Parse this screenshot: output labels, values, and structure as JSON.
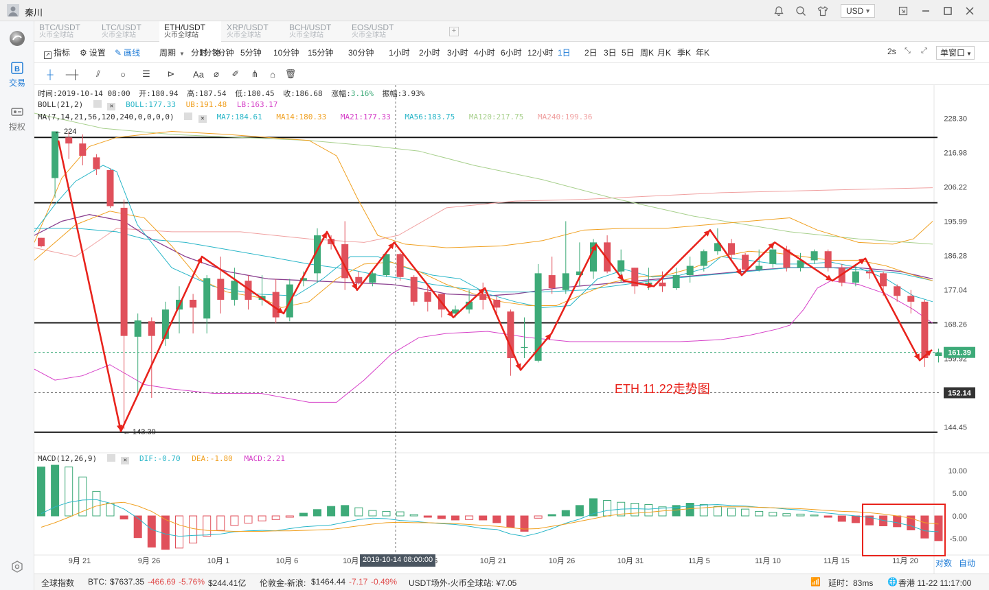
{
  "window": {
    "user_name": "秦川",
    "currency": "USD"
  },
  "sidebar": {
    "items": [
      {
        "label": "交易"
      },
      {
        "label": "授权"
      }
    ]
  },
  "tabs": [
    {
      "pair": "BTC/USDT",
      "exchange": "火币全球站"
    },
    {
      "pair": "LTC/USDT",
      "exchange": "火币全球站"
    },
    {
      "pair": "ETH/USDT",
      "exchange": "火币全球站"
    },
    {
      "pair": "XRP/USDT",
      "exchange": "火币全球站"
    },
    {
      "pair": "BCH/USDT",
      "exchange": "火币全球站"
    },
    {
      "pair": "EOS/USDT",
      "exchange": "火币全球站"
    }
  ],
  "active_tab": 2,
  "toolbar": {
    "indicators": "指标",
    "settings": "设置",
    "draw": "画线",
    "period": "周期",
    "periods": [
      "分时",
      "1分钟",
      "3分钟",
      "5分钟",
      "10分钟",
      "15分钟",
      "30分钟",
      "1小时",
      "2小时",
      "3小时",
      "4小时",
      "6小时",
      "12小时",
      "1日",
      "2日",
      "3日",
      "5日",
      "周K",
      "月K",
      "季K",
      "年K"
    ],
    "active_period": "1日",
    "refresh": "2s",
    "layout": "单窗口"
  },
  "drawtools": {
    "text_tool": "Aa"
  },
  "info": {
    "time_label": "时间:",
    "time": "2019-10-14 08:00",
    "open_label": "开:",
    "open": "180.94",
    "high_label": "高:",
    "high": "187.54",
    "low_label": "低:",
    "low": "180.45",
    "close_label": "收:",
    "close": "186.68",
    "change_label": "涨幅:",
    "change": "3.16%",
    "amp_label": "振幅:",
    "amp": "3.93%"
  },
  "boll": {
    "name": "BOLL(21,2)",
    "boll": "BOLL:177.33",
    "ub": "UB:191.48",
    "lb": "LB:163.17"
  },
  "ma": {
    "name": "MA(7,14,21,56,120,240,0,0,0,0)",
    "ma7": "MA7:184.61",
    "ma14": "MA14:180.33",
    "ma21": "MA21:177.33",
    "ma56": "MA56:183.75",
    "ma120": "MA120:217.75",
    "ma240": "MA240:199.36"
  },
  "macd": {
    "name": "MACD(12,26,9)",
    "dif": "DIF:-0.70",
    "dea": "DEA:-1.80",
    "macd": "MACD:2.21"
  },
  "annotation": "ETH 11.22走势图",
  "high_marker": "← 224",
  "low_marker": "← 143.39",
  "crosshair_label": "2019-10-14 08:00:00",
  "scale_mode": {
    "log": "对数",
    "auto": "自动"
  },
  "colors": {
    "up": "#3daa78",
    "down": "#e0505b",
    "accent": "#1e7bd6",
    "boll_mid": "#8a3f8f",
    "boll_up": "#f0a020",
    "ma_cyan": "#29b6c8",
    "ma120": "#a8d08d",
    "ma240": "#f0a0a0",
    "ma_magenta": "#d640c8",
    "arrow": "#e8231c"
  },
  "chart_data": {
    "type": "candlestick",
    "title": "ETH 11.22走势图",
    "xlabel": "",
    "ylabel": "",
    "price_ticks": [
      "228.30",
      "216.98",
      "206.22",
      "195.99",
      "186.28",
      "177.04",
      "168.26",
      "159.92",
      "152.14",
      "144.45"
    ],
    "current_price": "161.39",
    "dashed_level": "152.14",
    "macd_ticks": [
      "10.00",
      "5.00",
      "0.00",
      "-5.00"
    ],
    "date_ticks": [
      "9月 21",
      "9月 26",
      "10月 1",
      "10月 6",
      "10月 11",
      "10月 16",
      "10月 21",
      "10月 26",
      "10月 31",
      "11月 5",
      "11月 10",
      "11月 15",
      "11月 20"
    ],
    "horizontal_levels": [
      222,
      201.5,
      168.6,
      143.3
    ],
    "candles": [
      [
        191.3,
        188.9,
        191.3,
        188.6
      ],
      [
        209,
        224,
        224,
        203
      ],
      [
        222,
        220,
        224,
        215
      ],
      [
        220,
        216,
        223,
        213
      ],
      [
        215.5,
        211.8,
        216.5,
        210
      ],
      [
        211.5,
        200.5,
        212,
        200
      ],
      [
        200,
        165.4,
        202.5,
        144
      ],
      [
        165.2,
        169.2,
        171,
        152
      ],
      [
        169,
        165.4,
        170,
        151
      ],
      [
        164.7,
        172,
        174,
        163
      ],
      [
        172,
        174.5,
        178,
        166
      ],
      [
        174.5,
        172.5,
        176,
        166
      ],
      [
        169.7,
        180.2,
        181,
        166
      ],
      [
        180,
        174.5,
        186,
        171
      ],
      [
        174.5,
        179.5,
        183,
        173
      ],
      [
        179.5,
        174.5,
        181,
        172
      ],
      [
        174.5,
        175.5,
        181,
        173
      ],
      [
        176.5,
        170,
        180,
        168.5
      ],
      [
        170,
        178.5,
        180,
        169
      ],
      [
        179.5,
        180.2,
        182,
        178
      ],
      [
        181.5,
        192,
        194,
        179
      ],
      [
        191,
        189.5,
        192,
        188
      ],
      [
        189.5,
        180.2,
        196,
        177
      ],
      [
        180.5,
        179,
        182,
        178.5
      ],
      [
        179,
        181.5,
        182,
        178
      ],
      [
        181,
        186.7,
        187.5,
        180.5
      ],
      [
        186.7,
        180.5,
        187,
        179.5
      ],
      [
        180.5,
        174,
        181,
        173
      ],
      [
        176.5,
        174,
        178,
        171.5
      ],
      [
        176,
        172,
        176,
        170
      ],
      [
        171,
        172,
        173,
        170
      ],
      [
        172,
        174,
        177,
        171
      ],
      [
        176,
        174.5,
        179,
        172
      ],
      [
        174.5,
        172.5,
        175.5,
        171
      ],
      [
        171.5,
        160,
        172,
        156
      ],
      [
        162.5,
        162.7,
        170,
        160
      ],
      [
        159.4,
        181.5,
        184,
        159
      ],
      [
        181,
        177.5,
        186,
        176
      ],
      [
        177,
        181.5,
        196,
        176
      ],
      [
        181,
        182,
        190,
        178
      ],
      [
        182,
        190,
        191,
        180
      ],
      [
        190,
        182,
        192,
        181.5
      ],
      [
        182,
        185,
        188,
        179
      ],
      [
        183,
        178,
        183,
        176
      ],
      [
        178.5,
        179,
        183,
        177
      ],
      [
        179,
        178,
        182,
        176.5
      ],
      [
        177.5,
        181,
        183,
        177
      ],
      [
        181,
        183.5,
        186,
        179
      ],
      [
        183.5,
        187.5,
        188,
        182
      ],
      [
        187.5,
        189.8,
        194,
        186.5
      ],
      [
        189.8,
        186.5,
        191,
        185
      ],
      [
        186.5,
        182.5,
        187,
        181.5
      ],
      [
        182.5,
        183.5,
        188,
        182
      ],
      [
        184,
        188,
        190,
        183
      ],
      [
        188,
        183,
        189,
        182
      ],
      [
        183,
        185,
        187,
        182
      ],
      [
        185,
        187.5,
        188,
        184
      ],
      [
        187.5,
        183,
        188,
        182
      ],
      [
        183,
        179,
        184,
        178
      ],
      [
        179,
        182,
        184,
        178
      ],
      [
        182,
        181.5,
        184,
        180
      ],
      [
        181.5,
        178,
        182,
        175.5
      ],
      [
        178,
        175.5,
        178.5,
        174
      ],
      [
        175.5,
        174,
        177,
        171
      ],
      [
        174,
        160,
        174.5,
        158
      ],
      [
        160.5,
        161.4,
        162.3,
        159
      ]
    ],
    "macd_hist": [
      10.8,
      11.2,
      10.8,
      8.6,
      5.4,
      2.8,
      -0.7,
      -4.8,
      -6.9,
      -7.4,
      -7.1,
      -6,
      -4.5,
      -3.2,
      -2.1,
      -1.6,
      -1.1,
      -0.8,
      -0.3,
      0.6,
      1.4,
      2.1,
      2.3,
      1.8,
      1.2,
      1.0,
      0.9,
      0.3,
      -0.3,
      -0.6,
      -0.9,
      -0.8,
      -0.9,
      -1.5,
      -2.5,
      -3.4,
      -0.5,
      0.3,
      1.2,
      2.3,
      3.8,
      3.4,
      3.0,
      2.8,
      2.5,
      2.0,
      2.3,
      2.8,
      2.5,
      2.1,
      1.7,
      1.5,
      1.0,
      0.8,
      0.5,
      0.4,
      0.2,
      -0.3,
      -1.2,
      -1.5,
      -2.0,
      -2.2,
      -2.4,
      -3.1,
      -4.9,
      -5.5
    ],
    "dif": [
      0.5,
      2,
      3,
      3.5,
      3.6,
      2.8,
      1.5,
      -0.5,
      -3,
      -4,
      -4.5,
      -4.3,
      -4.2,
      -4.0,
      -3.5,
      -3.3,
      -3.2,
      -3.3,
      -2.8,
      -2.4,
      -2.2,
      -2.0,
      -1.4,
      -0.8,
      -0.5,
      -0.6,
      -1.0,
      -1.2,
      -1.5,
      -1.7,
      -1.9,
      -2.3,
      -2.8,
      -3.0,
      -4.0,
      -4.5,
      -3.8,
      -2.8,
      -1.6,
      -0.7,
      0.5,
      1.2,
      1.5,
      1.6,
      1.5,
      1.7,
      1.9,
      2.2,
      2.4,
      2.5,
      2.3,
      2.2,
      1.9,
      1.8,
      1.5,
      1.3,
      0.9,
      0.6,
      0.3,
      0.0,
      -0.3,
      -1.0,
      -1.5,
      -2.2,
      -3.3,
      -3.5
    ],
    "dea": [
      -2.5,
      -1.5,
      -0.3,
      1.0,
      2.2,
      2.8,
      3.0,
      2.2,
      1.0,
      -0.8,
      -2,
      -2.8,
      -3.2,
      -3.3,
      -3.4,
      -3.4,
      -3.4,
      -3.3,
      -3.3,
      -3.2,
      -3.1,
      -3.0,
      -2.6,
      -2.2,
      -1.8,
      -1.5,
      -1.4,
      -1.5,
      -1.5,
      -1.6,
      -1.7,
      -1.9,
      -2.1,
      -2.3,
      -2.6,
      -2.9,
      -2.8,
      -2.3,
      -1.8,
      -1.2,
      -0.6,
      0.0,
      0.4,
      0.6,
      0.8,
      1.1,
      1.3,
      1.6,
      1.8,
      2.0,
      2.0,
      2.0,
      1.9,
      1.8,
      1.7,
      1.6,
      1.4,
      1.2,
      1.0,
      0.9,
      0.7,
      0.4,
      0.0,
      -0.5,
      -1.5,
      -1.8
    ]
  }
}
